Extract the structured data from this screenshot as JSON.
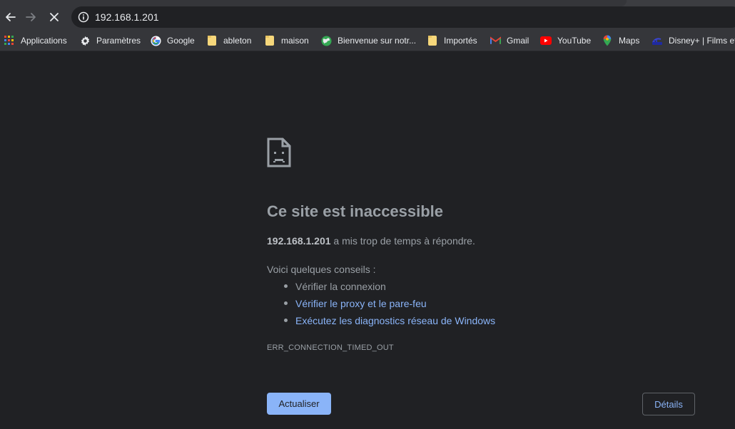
{
  "toolbar": {
    "url": "192.168.1.201"
  },
  "bookmarks": [
    {
      "label": "Applications",
      "icon": "apps-grid-icon"
    },
    {
      "label": "Paramètres",
      "icon": "gear-icon"
    },
    {
      "label": "Google",
      "icon": "google-icon"
    },
    {
      "label": "ableton",
      "icon": "folder-icon"
    },
    {
      "label": "maison",
      "icon": "folder-icon"
    },
    {
      "label": "Bienvenue sur notr...",
      "icon": "globe-icon"
    },
    {
      "label": "Importés",
      "icon": "folder-icon"
    },
    {
      "label": "Gmail",
      "icon": "gmail-icon"
    },
    {
      "label": "YouTube",
      "icon": "youtube-icon"
    },
    {
      "label": "Maps",
      "icon": "maps-icon"
    },
    {
      "label": "Disney+ | Films et",
      "icon": "disney-icon"
    }
  ],
  "error": {
    "title": "Ce site est inaccessible",
    "host": "192.168.1.201",
    "message": " a mis trop de temps à répondre.",
    "tips_heading": "Voici quelques conseils :",
    "tips": [
      "Vérifier la connexion",
      "Vérifier le proxy et le pare-feu",
      "Exécutez les diagnostics réseau de Windows"
    ],
    "code": "ERR_CONNECTION_TIMED_OUT",
    "reload_label": "Actualiser",
    "details_label": "Détails"
  },
  "colors": {
    "background": "#202124",
    "toolbar": "#35363a",
    "link": "#8ab4f8",
    "muted_text": "#9aa0a6"
  }
}
